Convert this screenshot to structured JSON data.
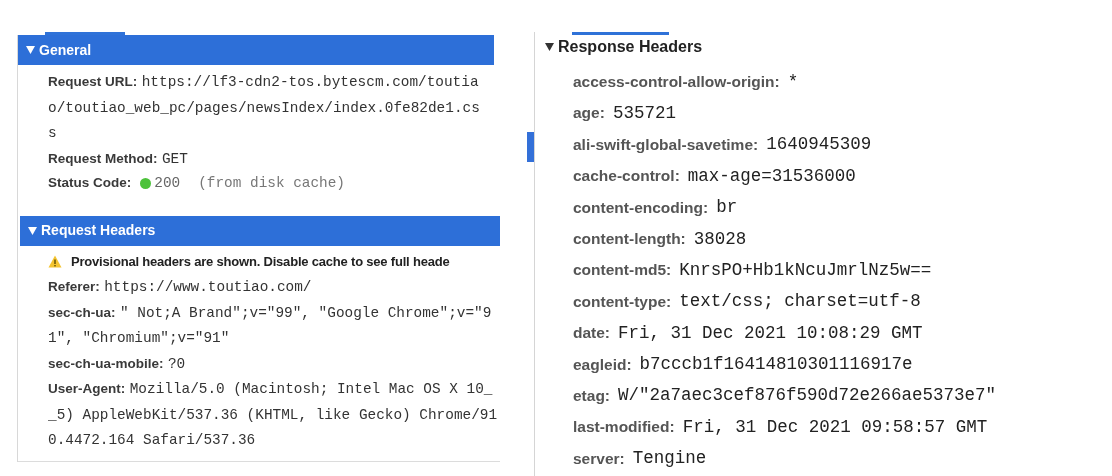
{
  "request_panel": {
    "sections": [
      {
        "title": "General",
        "expanded": true,
        "rows": [
          {
            "kind": "field",
            "label": "Request URL:",
            "value": "https://lf3-cdn2-tos.bytescm.com/toutia\no/toutiao_web_pc/pages/newsIndex/index.0fe82de1.cs\ns"
          },
          {
            "kind": "field",
            "label": "Request Method:",
            "value": "GET"
          },
          {
            "kind": "status",
            "label": "Status Code:",
            "color": "#4cc23a",
            "value": "200",
            "note": "(from disk cache)"
          }
        ]
      },
      {
        "title": "Request Headers",
        "expanded": true,
        "rows": [
          {
            "kind": "warning",
            "text": "Provisional headers are shown. Disable cache to see full heade"
          },
          {
            "kind": "field",
            "label": "Referer:",
            "value": "https://www.toutiao.com/"
          },
          {
            "kind": "field",
            "label": "sec-ch-ua:",
            "value": "\" Not;A Brand\";v=\"99\", \"Google Chrome\";v=\"9\n1\", \"Chromium\";v=\"91\""
          },
          {
            "kind": "field",
            "label": "sec-ch-ua-mobile:",
            "value": "?0"
          },
          {
            "kind": "field",
            "label": "User-Agent:",
            "value": "Mozilla/5.0 (Macintosh; Intel Mac OS X 10_\n_5) AppleWebKit/537.36 (KHTML, like Gecko) Chrome/91\n0.4472.164 Safari/537.36"
          }
        ]
      }
    ]
  },
  "response_panel": {
    "title": "Response Headers",
    "expanded": true,
    "rows": [
      {
        "label": "access-control-allow-origin:",
        "value": "*"
      },
      {
        "label": "age:",
        "value": "535721"
      },
      {
        "label": "ali-swift-global-savetime:",
        "value": "1640945309"
      },
      {
        "label": "cache-control:",
        "value": "max-age=31536000"
      },
      {
        "label": "content-encoding:",
        "value": "br"
      },
      {
        "label": "content-length:",
        "value": "38028"
      },
      {
        "label": "content-md5:",
        "value": "KnrsPO+Hb1kNcuJmrlNz5w=="
      },
      {
        "label": "content-type:",
        "value": "text/css; charset=utf-8"
      },
      {
        "label": "date:",
        "value": "Fri, 31 Dec 2021 10:08:29 GMT"
      },
      {
        "label": "eagleid:",
        "value": "b7cccb1f16414810301116917e"
      },
      {
        "label": "etag:",
        "value": "W/\"2a7aec3cef876f590d72e266ae5373e7\""
      },
      {
        "label": "last-modified:",
        "value": "Fri, 31 Dec 2021 09:58:57 GMT"
      },
      {
        "label": "server:",
        "value": "Tengine"
      }
    ]
  }
}
